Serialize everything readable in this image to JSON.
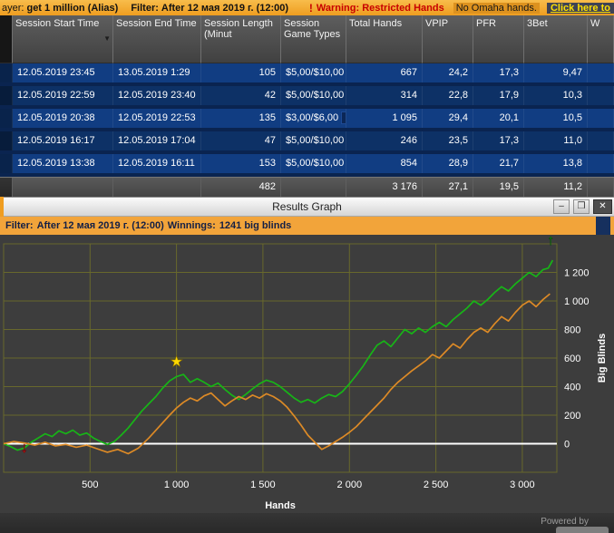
{
  "top_bar": {
    "player_label": "ayer:",
    "player_value": "get 1 million (Alias)",
    "filter_label": "Filter:",
    "filter_value": "After 12 мая 2019 г. (12:00)",
    "warning_icon": "!",
    "warning_text": "Warning: Restricted Hands",
    "warning_detail": "No Omaha hands.",
    "warning_link": "Click here to"
  },
  "session_table": {
    "columns": [
      "",
      "Session Start Time",
      "Session End Time",
      "Session Length (Minut",
      "Session Game Types",
      "Total Hands",
      "VPIP",
      "PFR",
      "3Bet",
      "W"
    ],
    "sort_icon": "▼",
    "rows": [
      {
        "start": "12.05.2019 23:45",
        "end": "13.05.2019 1:29",
        "length": "105",
        "games": "$5,00/$10,00",
        "hands": "667",
        "vpip": "24,2",
        "pfr": "17,3",
        "threebet": "9,47",
        "second_chip": false
      },
      {
        "start": "12.05.2019 22:59",
        "end": "12.05.2019 23:40",
        "length": "42",
        "games": "$5,00/$10,00",
        "hands": "314",
        "vpip": "22,8",
        "pfr": "17,9",
        "threebet": "10,3",
        "second_chip": false
      },
      {
        "start": "12.05.2019 20:38",
        "end": "12.05.2019 22:53",
        "length": "135",
        "games": "$3,00/$6,00",
        "hands": "1 095",
        "vpip": "29,4",
        "pfr": "20,1",
        "threebet": "10,5",
        "second_chip": true
      },
      {
        "start": "12.05.2019 16:17",
        "end": "12.05.2019 17:04",
        "length": "47",
        "games": "$5,00/$10,00",
        "hands": "246",
        "vpip": "23,5",
        "pfr": "17,3",
        "threebet": "11,0",
        "second_chip": false
      },
      {
        "start": "12.05.2019 13:38",
        "end": "12.05.2019 16:11",
        "length": "153",
        "games": "$5,00/$10,00",
        "hands": "854",
        "vpip": "28,9",
        "pfr": "21,7",
        "threebet": "13,8",
        "second_chip": false
      }
    ],
    "summary": {
      "length": "482",
      "hands": "3 176",
      "vpip": "27,1",
      "pfr": "19,5",
      "threebet": "11,2"
    }
  },
  "graph_window": {
    "title": "Results Graph",
    "minimize_glyph": "–",
    "maximize_glyph": "❒",
    "close_glyph": "✕",
    "filter_bar": {
      "filter_label": "Filter:",
      "filter_value": "After 12 мая 2019 г. (12:00)",
      "winnings_label": "Winnings:",
      "winnings_value": "1241 big blinds"
    },
    "powered_by": "Powered by"
  },
  "chart_data": {
    "type": "line",
    "title": "Results Graph",
    "xlabel": "Hands",
    "ylabel": "Big Blinds",
    "xlim": [
      0,
      3200
    ],
    "ylim": [
      -200,
      1400
    ],
    "grid": true,
    "grid_color": "#68682c",
    "background": "#3d3d3d",
    "zero_line_color": "#ffffff",
    "x_ticks": [
      500,
      1000,
      1500,
      2000,
      2500,
      3000
    ],
    "x_tick_labels": [
      "500",
      "1 000",
      "1 500",
      "2 000",
      "2 500",
      "3 000"
    ],
    "y_ticks": [
      0,
      200,
      400,
      600,
      800,
      1000,
      1200
    ],
    "y_tick_labels": [
      "0",
      "200",
      "400",
      "600",
      "800",
      "1 000",
      "1 200"
    ],
    "series": [
      {
        "name": "winnings-big-blinds",
        "color": "#17b517",
        "points": [
          [
            0,
            0
          ],
          [
            40,
            -20
          ],
          [
            80,
            -45
          ],
          [
            120,
            -30
          ],
          [
            160,
            10
          ],
          [
            200,
            40
          ],
          [
            240,
            70
          ],
          [
            280,
            50
          ],
          [
            320,
            90
          ],
          [
            360,
            70
          ],
          [
            400,
            95
          ],
          [
            440,
            60
          ],
          [
            480,
            75
          ],
          [
            520,
            40
          ],
          [
            560,
            15
          ],
          [
            600,
            -5
          ],
          [
            640,
            15
          ],
          [
            680,
            60
          ],
          [
            720,
            110
          ],
          [
            760,
            170
          ],
          [
            800,
            230
          ],
          [
            840,
            280
          ],
          [
            880,
            330
          ],
          [
            920,
            390
          ],
          [
            960,
            440
          ],
          [
            1000,
            470
          ],
          [
            1040,
            485
          ],
          [
            1080,
            430
          ],
          [
            1120,
            455
          ],
          [
            1160,
            430
          ],
          [
            1200,
            400
          ],
          [
            1240,
            425
          ],
          [
            1280,
            380
          ],
          [
            1320,
            340
          ],
          [
            1360,
            310
          ],
          [
            1400,
            345
          ],
          [
            1440,
            385
          ],
          [
            1480,
            420
          ],
          [
            1520,
            445
          ],
          [
            1560,
            430
          ],
          [
            1600,
            400
          ],
          [
            1640,
            360
          ],
          [
            1680,
            320
          ],
          [
            1720,
            290
          ],
          [
            1760,
            310
          ],
          [
            1800,
            285
          ],
          [
            1840,
            320
          ],
          [
            1880,
            345
          ],
          [
            1920,
            330
          ],
          [
            1960,
            365
          ],
          [
            2000,
            420
          ],
          [
            2040,
            480
          ],
          [
            2080,
            545
          ],
          [
            2120,
            620
          ],
          [
            2160,
            690
          ],
          [
            2200,
            720
          ],
          [
            2240,
            680
          ],
          [
            2280,
            740
          ],
          [
            2320,
            800
          ],
          [
            2360,
            770
          ],
          [
            2400,
            810
          ],
          [
            2440,
            780
          ],
          [
            2480,
            820
          ],
          [
            2520,
            850
          ],
          [
            2560,
            820
          ],
          [
            2600,
            870
          ],
          [
            2640,
            910
          ],
          [
            2680,
            950
          ],
          [
            2720,
            1000
          ],
          [
            2760,
            970
          ],
          [
            2800,
            1010
          ],
          [
            2840,
            1060
          ],
          [
            2880,
            1100
          ],
          [
            2920,
            1070
          ],
          [
            2960,
            1120
          ],
          [
            3000,
            1160
          ],
          [
            3040,
            1200
          ],
          [
            3080,
            1170
          ],
          [
            3120,
            1220
          ],
          [
            3150,
            1230
          ],
          [
            3176,
            1285
          ]
        ]
      },
      {
        "name": "ev-big-blinds",
        "color": "#dd8a26",
        "points": [
          [
            0,
            0
          ],
          [
            60,
            15
          ],
          [
            120,
            5
          ],
          [
            180,
            -10
          ],
          [
            240,
            10
          ],
          [
            300,
            -15
          ],
          [
            360,
            -5
          ],
          [
            420,
            -25
          ],
          [
            480,
            -10
          ],
          [
            540,
            -35
          ],
          [
            600,
            -60
          ],
          [
            660,
            -40
          ],
          [
            720,
            -70
          ],
          [
            780,
            -30
          ],
          [
            840,
            40
          ],
          [
            900,
            120
          ],
          [
            960,
            200
          ],
          [
            1000,
            250
          ],
          [
            1040,
            290
          ],
          [
            1080,
            320
          ],
          [
            1120,
            300
          ],
          [
            1160,
            335
          ],
          [
            1200,
            355
          ],
          [
            1240,
            310
          ],
          [
            1280,
            265
          ],
          [
            1320,
            300
          ],
          [
            1360,
            330
          ],
          [
            1400,
            310
          ],
          [
            1440,
            340
          ],
          [
            1480,
            320
          ],
          [
            1520,
            350
          ],
          [
            1560,
            330
          ],
          [
            1600,
            300
          ],
          [
            1640,
            255
          ],
          [
            1680,
            195
          ],
          [
            1720,
            130
          ],
          [
            1760,
            60
          ],
          [
            1800,
            10
          ],
          [
            1840,
            -40
          ],
          [
            1880,
            -15
          ],
          [
            1920,
            15
          ],
          [
            1960,
            45
          ],
          [
            2000,
            80
          ],
          [
            2040,
            120
          ],
          [
            2080,
            170
          ],
          [
            2120,
            220
          ],
          [
            2160,
            270
          ],
          [
            2200,
            320
          ],
          [
            2240,
            380
          ],
          [
            2280,
            430
          ],
          [
            2320,
            470
          ],
          [
            2360,
            510
          ],
          [
            2400,
            545
          ],
          [
            2440,
            580
          ],
          [
            2480,
            625
          ],
          [
            2520,
            600
          ],
          [
            2560,
            650
          ],
          [
            2600,
            700
          ],
          [
            2640,
            670
          ],
          [
            2680,
            730
          ],
          [
            2720,
            780
          ],
          [
            2760,
            810
          ],
          [
            2800,
            780
          ],
          [
            2840,
            840
          ],
          [
            2880,
            890
          ],
          [
            2920,
            860
          ],
          [
            2960,
            920
          ],
          [
            3000,
            970
          ],
          [
            3040,
            1000
          ],
          [
            3080,
            960
          ],
          [
            3120,
            1010
          ],
          [
            3160,
            1050
          ]
        ]
      }
    ],
    "markers": [
      {
        "type": "star",
        "x": 1000,
        "y": 540,
        "color": "#ffd900"
      },
      {
        "type": "arrow-down",
        "x": 120,
        "y": -60,
        "color": "#e22222"
      },
      {
        "type": "arrow-up",
        "x": 3165,
        "y": 1395,
        "color": "#17b517"
      }
    ]
  }
}
